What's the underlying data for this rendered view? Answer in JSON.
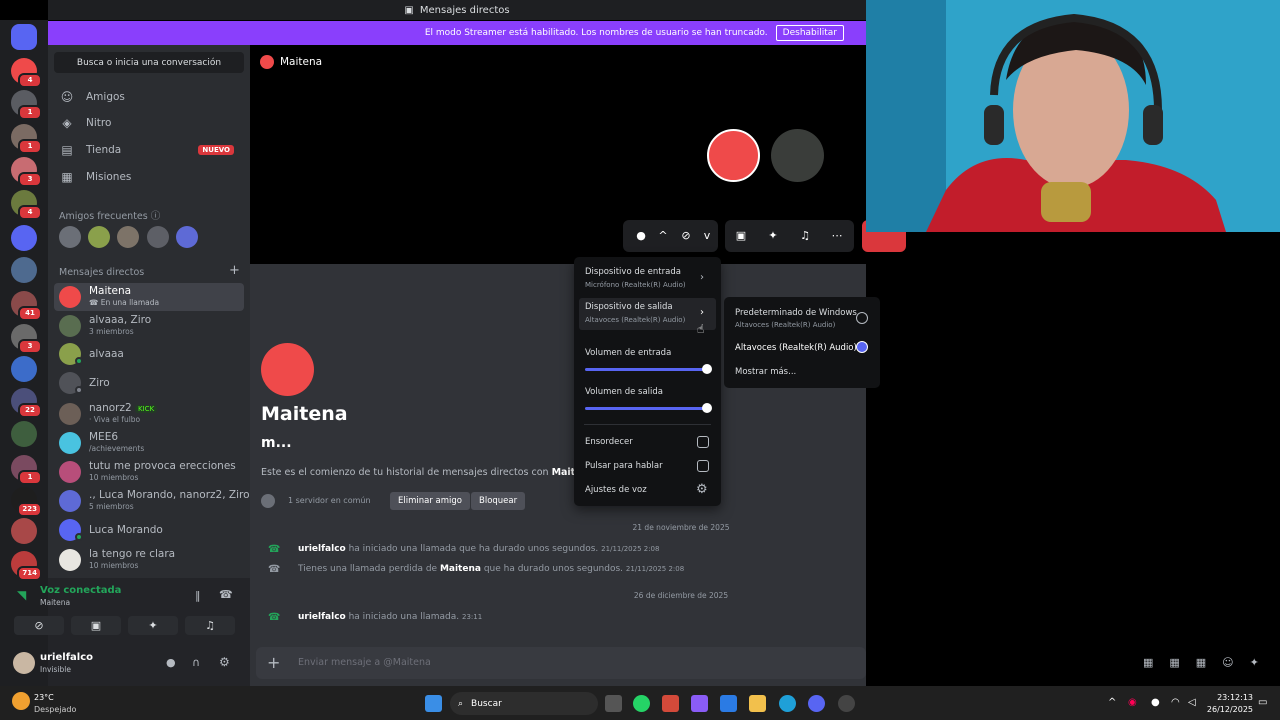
{
  "title_bar": {
    "title": "Mensajes directos"
  },
  "streamer_bar": {
    "text": "El modo Streamer está habilitado. Los nombres de usuario se han truncado.",
    "button": "Deshabilitar"
  },
  "servers": [
    {
      "badge": ""
    },
    {
      "badge": "4"
    },
    {
      "badge": "1"
    },
    {
      "badge": "1"
    },
    {
      "badge": "3"
    },
    {
      "badge": "4"
    },
    {
      "badge": ""
    },
    {
      "badge": ""
    },
    {
      "badge": "41"
    },
    {
      "badge": "3"
    },
    {
      "badge": ""
    },
    {
      "badge": "22"
    },
    {
      "badge": ""
    },
    {
      "badge": "1"
    },
    {
      "badge": "223"
    },
    {
      "badge": ""
    },
    {
      "badge": "714"
    }
  ],
  "sidebar": {
    "search_placeholder": "Busca o inicia una conversación",
    "nav": [
      {
        "label": "Amigos",
        "icon": "friends-icon"
      },
      {
        "label": "Nitro",
        "icon": "nitro-icon"
      },
      {
        "label": "Tienda",
        "icon": "shop-icon",
        "badge": "NUEVO"
      },
      {
        "label": "Misiones",
        "icon": "quests-icon"
      }
    ],
    "frequent_friends_label": "Amigos frecuentes",
    "dm_header": "Mensajes directos",
    "dms": [
      {
        "name": "Maitena",
        "sub": "En una llamada",
        "selected": true
      },
      {
        "name": "alvaaa, Ziro",
        "sub": "3 miembros"
      },
      {
        "name": "alvaaa",
        "sub": ""
      },
      {
        "name": "Ziro",
        "sub": ""
      },
      {
        "name": "nanorz2",
        "tag": "KICK",
        "sub": "· Viva el fulbo"
      },
      {
        "name": "MEE6",
        "sub": "/achievements"
      },
      {
        "name": "tutu me provoca erecciones",
        "sub": "10 miembros"
      },
      {
        "name": "., Luca Morando, nanorz2, Ziro",
        "sub": "5 miembros"
      },
      {
        "name": "Luca Morando",
        "sub": ""
      },
      {
        "name": "la tengo re clara",
        "sub": "10 miembros"
      }
    ]
  },
  "voice": {
    "status": "Voz conectada",
    "channel": "Maitena"
  },
  "user": {
    "name": "urielfalco",
    "status": "Invisible"
  },
  "main": {
    "channel_name": "Maitena",
    "intro_name": "Maitena",
    "intro_sub": "m...",
    "intro_text": "Este es el comienzo de tu historial de mensajes directos con ",
    "intro_text_bold": "Maitena",
    "mutual": "1 servidor en común",
    "remove_friend": "Eliminar amigo",
    "block": "Bloquear",
    "date1": "21 de noviembre de 2025",
    "date2": "26 de diciembre de 2025",
    "messages": [
      {
        "user": "urielfalco",
        "text": "ha iniciado una llamada que ha durado unos segundos.",
        "time": "21/11/2025 2:08"
      },
      {
        "prefix": "Tienes una llamada perdida de ",
        "user": "Maitena",
        "text": "que ha durado unos segundos.",
        "time": "21/11/2025 2:08"
      },
      {
        "user": "urielfalco",
        "text": "ha iniciado una llamada.",
        "time": "23:11"
      }
    ],
    "composer_placeholder": "Enviar mensaje a @Maitena"
  },
  "device_menu": {
    "input_device": "Dispositivo de entrada",
    "input_device_sub": "Micrófono (Realtek(R) Audio)",
    "output_device": "Dispositivo de salida",
    "output_device_sub": "Altavoces (Realtek(R) Audio)",
    "input_volume": "Volumen de entrada",
    "output_volume": "Volumen de salida",
    "input_volume_level": 1.0,
    "output_volume_level": 1.0,
    "deafen": "Ensordecer",
    "push_to_talk": "Pulsar para hablar",
    "voice_settings": "Ajustes de voz"
  },
  "output_submenu": {
    "opt1": "Predeterminado de Windows",
    "opt1_sub": "Altavoces (Realtek(R) Audio)",
    "opt2": "Altavoces (Realtek(R) Audio)",
    "opt2_selected": true,
    "more": "Mostrar más..."
  },
  "taskbar": {
    "weather_temp": "23°C",
    "weather_desc": "Despejado",
    "search": "Buscar",
    "time": "23:12:13",
    "date": "26/12/2025"
  },
  "colors": {
    "accent": "#5865f2",
    "danger": "#da373c",
    "online": "#23a55a",
    "streamer": "#8a3ffc"
  }
}
